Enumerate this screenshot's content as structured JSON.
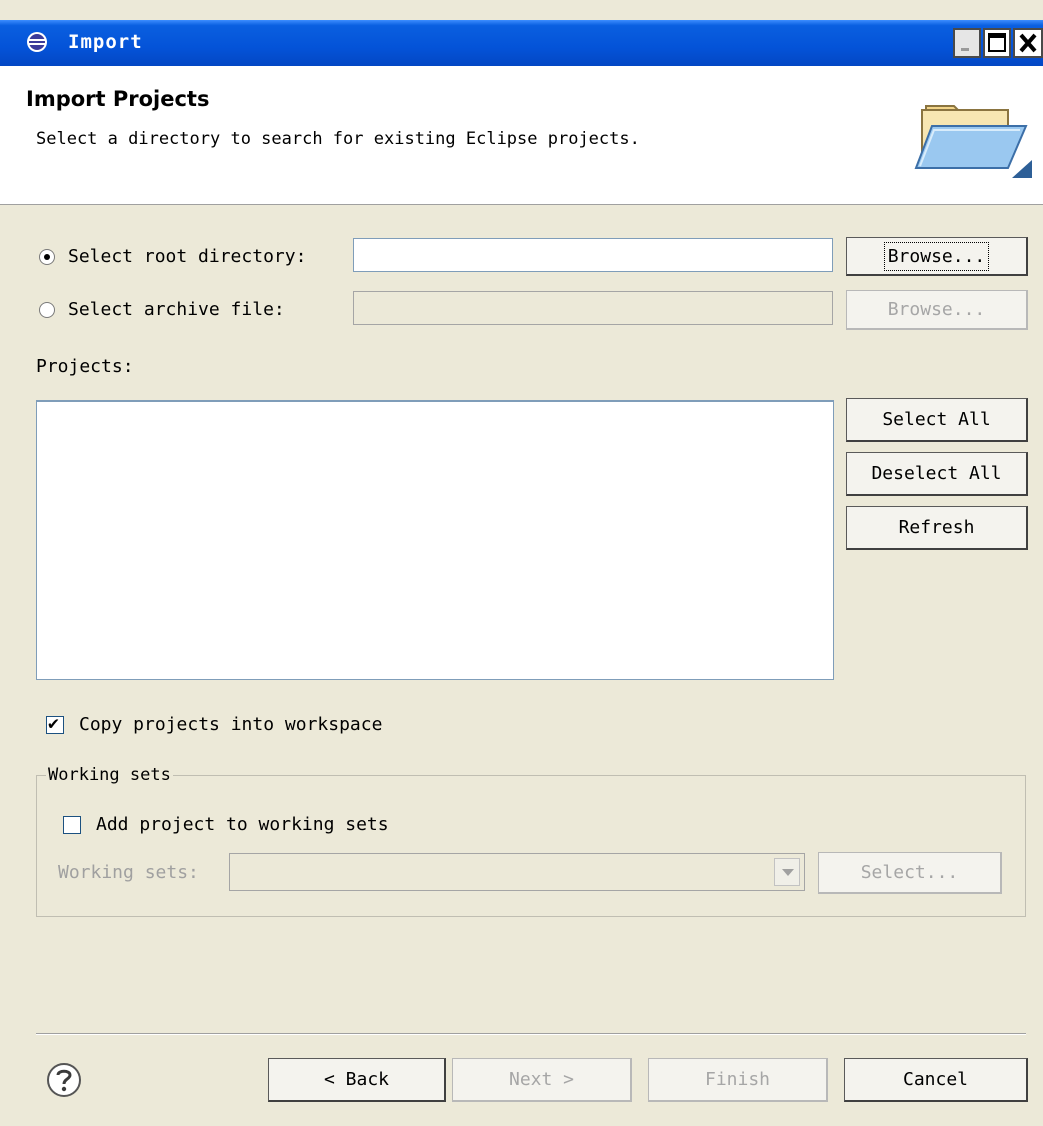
{
  "window": {
    "title": "Import"
  },
  "header": {
    "title": "Import Projects",
    "description": "Select a directory to search for existing Eclipse projects."
  },
  "source": {
    "root_dir_label": "Select root directory:",
    "root_dir_selected": true,
    "root_dir_value": "",
    "archive_label": "Select archive file:",
    "archive_selected": false,
    "archive_value": "",
    "browse_label": "Browse...",
    "browse_archive_label": "Browse..."
  },
  "projects": {
    "label": "Projects:",
    "items": [],
    "select_all_label": "Select All",
    "deselect_all_label": "Deselect All",
    "refresh_label": "Refresh"
  },
  "copy_into_workspace": {
    "label": "Copy projects into workspace",
    "checked": true
  },
  "working_sets": {
    "group_label": "Working sets",
    "add_label": "Add project to working sets",
    "add_checked": false,
    "sets_label": "Working sets:",
    "sets_value": "",
    "select_label": "Select..."
  },
  "footer": {
    "back_label": "< Back",
    "next_label": "Next >",
    "finish_label": "Finish",
    "cancel_label": "Cancel"
  }
}
